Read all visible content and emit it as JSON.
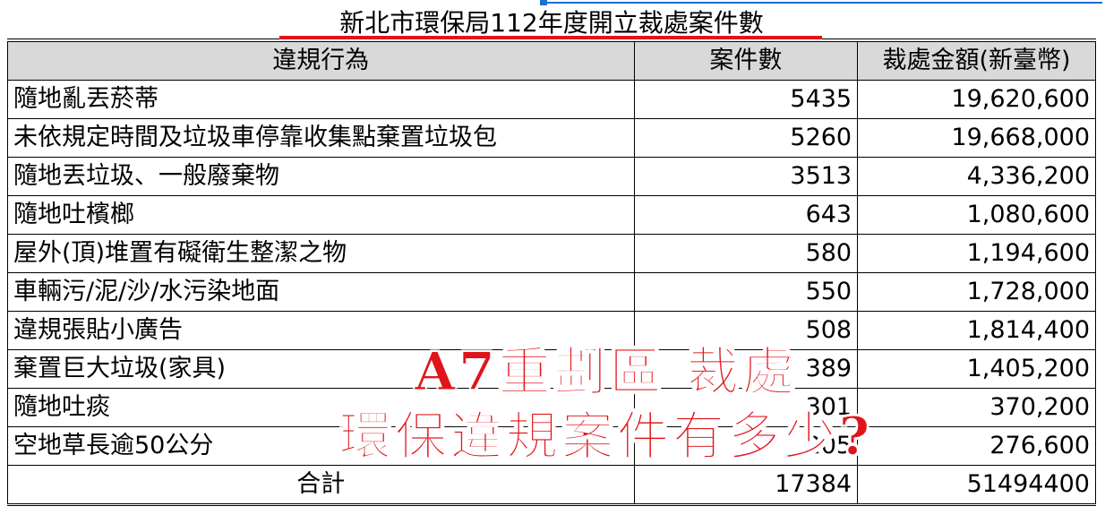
{
  "title": "新北市環保局112年度開立裁處案件數",
  "headers": [
    "違規行為",
    "案件數",
    "裁處金額(新臺幣)"
  ],
  "rows": [
    [
      "隨地亂丟菸蒂",
      "5435",
      "19,620,600"
    ],
    [
      "未依規定時間及垃圾車停靠收集點棄置垃圾包",
      "5260",
      "19,668,000"
    ],
    [
      "隨地丟垃圾、一般廢棄物",
      "3513",
      "4,336,200"
    ],
    [
      "隨地吐檳榔",
      "643",
      "1,080,600"
    ],
    [
      "屋外(頂)堆置有礙衛生整潔之物",
      "580",
      "1,194,600"
    ],
    [
      "車輛污/泥/沙/水污染地面",
      "550",
      "1,728,000"
    ],
    [
      "違規張貼小廣告",
      "508",
      "1,814,400"
    ],
    [
      "棄置巨大垃圾(家具)",
      "389",
      "1,405,200"
    ],
    [
      "隨地吐痰",
      "301",
      "370,200"
    ],
    [
      "空地草長逾50公分",
      "205",
      "276,600"
    ]
  ],
  "total": [
    "合計",
    "17384",
    "51494400"
  ],
  "overlay": {
    "line1": "A7重劃區 裁處",
    "line2": "環保違規案件有多少?"
  },
  "colors": {
    "accent": "#e0151b",
    "header_bg": "#d9d9d9",
    "selection": "#1a6fd1"
  }
}
